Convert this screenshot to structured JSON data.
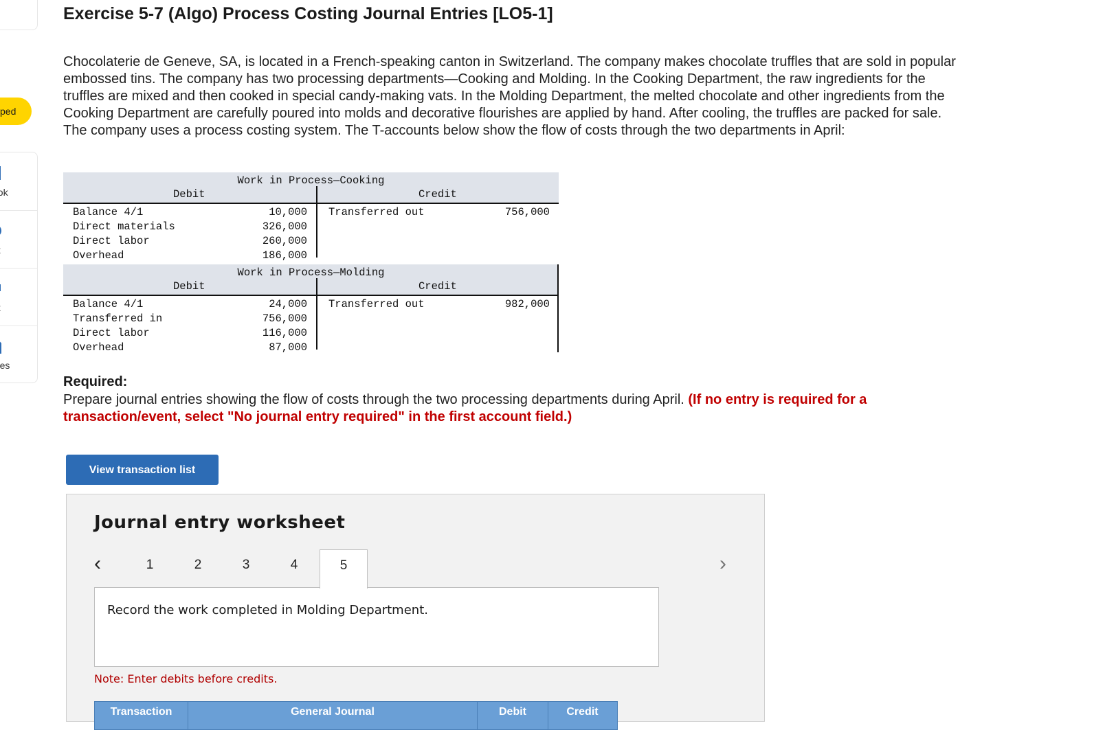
{
  "sidebar": {
    "pill_label": "ped",
    "items": [
      {
        "label": "ook",
        "icon": "book-icon"
      },
      {
        "label": "nt",
        "icon": "print-icon"
      },
      {
        "label": "nt",
        "icon": "print-icon"
      },
      {
        "label": "ences",
        "icon": "references-icon"
      }
    ]
  },
  "title": "Exercise 5-7 (Algo) Process Costing Journal Entries [LO5-1]",
  "intro": "Chocolaterie de Geneve, SA, is located in a French-speaking canton in Switzerland. The company makes chocolate truffles that are sold in popular embossed tins. The company has two processing departments—Cooking and Molding. In the Cooking Department, the raw ingredients for the truffles are mixed and then cooked in special candy-making vats. In the Molding Department, the melted chocolate and other ingredients from the Cooking Department are carefully poured into molds and decorative flourishes are applied by hand. After cooling, the truffles are packed for sale. The company uses a process costing system. The T-accounts below show the flow of costs through the two departments in April:",
  "t_accounts": {
    "cooking": {
      "title": "Work in Process—Cooking",
      "debit_label": "Debit",
      "credit_label": "Credit",
      "debits": [
        {
          "label": "Balance 4/1",
          "amount": "10,000"
        },
        {
          "label": "Direct materials",
          "amount": "326,000"
        },
        {
          "label": "Direct labor",
          "amount": "260,000"
        },
        {
          "label": "Overhead",
          "amount": "186,000"
        }
      ],
      "credit": {
        "label": "Transferred out",
        "amount": "756,000"
      }
    },
    "molding": {
      "title": "Work in Process—Molding",
      "debit_label": "Debit",
      "credit_label": "Credit",
      "debits": [
        {
          "label": "Balance 4/1",
          "amount": "24,000"
        },
        {
          "label": "Transferred in",
          "amount": "756,000"
        },
        {
          "label": "Direct labor",
          "amount": "116,000"
        },
        {
          "label": "Overhead",
          "amount": "87,000"
        }
      ],
      "credit": {
        "label": "Transferred out",
        "amount": "982,000"
      }
    }
  },
  "required": {
    "heading": "Required:",
    "text": "Prepare journal entries showing the flow of costs through the two processing departments during April.",
    "instruction": "(If no entry is required for a transaction/event, select \"No journal entry required\" in the first account field.)"
  },
  "view_button": "View transaction list",
  "worksheet": {
    "title": "Journal entry worksheet",
    "tabs": [
      "1",
      "2",
      "3",
      "4",
      "5"
    ],
    "active_tab": "5",
    "prev_glyph": "‹",
    "next_glyph": "›",
    "description": "Record the work completed in Molding Department.",
    "note": "Note: Enter debits before credits.",
    "table_headers": [
      "Transaction",
      "General Journal",
      "Debit",
      "Credit"
    ]
  },
  "colors": {
    "pill": "#ffd400",
    "button": "#2d6cb5",
    "red_text": "#c00000",
    "table_header": "#6a9fd6"
  }
}
